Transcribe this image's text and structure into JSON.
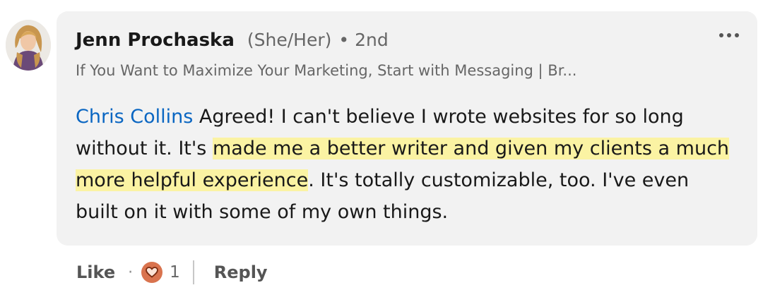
{
  "comment": {
    "author": {
      "name": "Jenn Prochaska",
      "pronouns": "(She/Her)",
      "separator": "•",
      "degree": "2nd",
      "headline": "If You Want to Maximize Your Marketing, Start with Messaging | Br..."
    },
    "body": {
      "mention": "Chris Collins",
      "text_before": " Agreed! I can't believe I wrote websites for so long without it. It's ",
      "highlighted": "made me a better writer and given my clients a much more helpful experience",
      "text_after": ". It's totally customizable, too. I've even built on it with some of my own things."
    },
    "more_icon": "ellipsis-icon"
  },
  "actions": {
    "like_label": "Like",
    "separator": "·",
    "reaction_icon": "heart-icon",
    "reaction_count": "1",
    "reply_label": "Reply"
  },
  "colors": {
    "bubble_bg": "#f2f2f2",
    "mention": "#0a66c2",
    "highlight": "#fbf3a3",
    "heart_badge": "#d9734e",
    "muted_text": "#666666"
  }
}
